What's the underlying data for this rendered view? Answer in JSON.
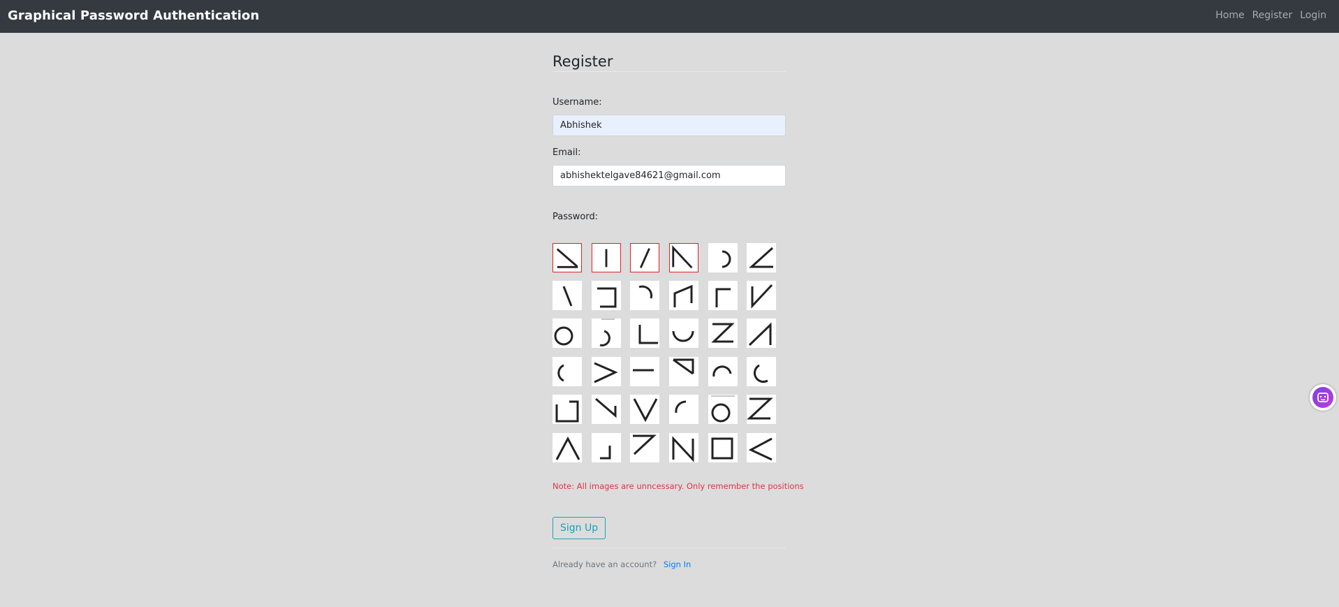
{
  "navbar": {
    "brand": "Graphical Password Authentication",
    "links": [
      "Home",
      "Register",
      "Login"
    ]
  },
  "form": {
    "title": "Register",
    "username_label": "Username:",
    "username_value": "Abhishek",
    "email_label": "Email:",
    "email_value": "abhishektelgave84621@gmail.com",
    "password_label": "Password:",
    "note": "Note: All images are unncessary. Only remember the positions",
    "submit_label": "Sign Up",
    "footer_text": "Already have an account?",
    "footer_link": "Sign In"
  },
  "grid": {
    "rows": 6,
    "cols": 6,
    "selected_positions": [
      0,
      1,
      2,
      3
    ],
    "symbols": [
      "diag-bar-bottom",
      "vertical-bar",
      "slash",
      "n-corner",
      "right-arc",
      "angle-bottom-left",
      "backslash",
      "square-open-left",
      "top-right-arc",
      "n-shape-wide",
      "corner-top-left",
      "check-v",
      "circle",
      "hook-bottom",
      "corner-bottom-left",
      "cup",
      "z-reverse",
      "triangle-right-up",
      "left-arc",
      "greater-than",
      "horizontal-bar",
      "seven-reverse",
      "cap-arc",
      "left-small-arc",
      "square-open-right",
      "backslash-corner",
      "v-shape",
      "top-left-arc",
      "circle-bar-top",
      "z-shape",
      "lambda",
      "corner-bottom-right",
      "seven",
      "n-letter",
      "square",
      "less-than"
    ]
  },
  "colors": {
    "navbar": "#343a40",
    "selected_border": "#e02020",
    "note": "#dc3545",
    "button": "#17a2b8",
    "link": "#007bff"
  }
}
